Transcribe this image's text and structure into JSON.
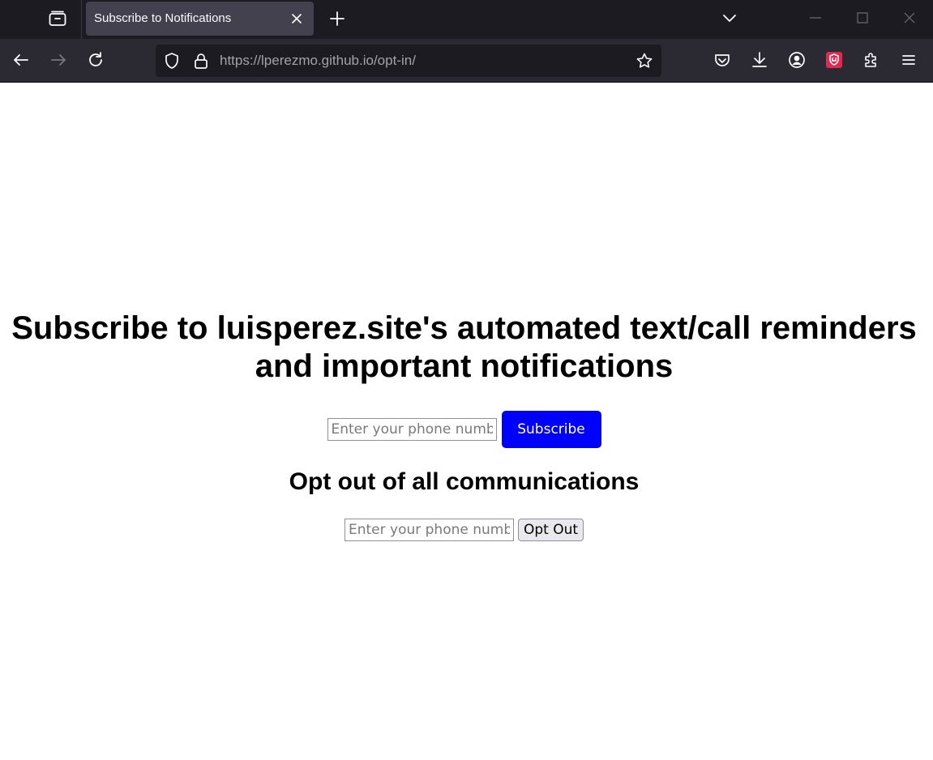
{
  "browser": {
    "tab_title": "Subscribe to Notifications",
    "url_host": "https://lperezmo.github.io",
    "url_path": "/opt-in/"
  },
  "icons": {
    "tab_overview": "tab-overview-icon",
    "close_tab": "close-icon",
    "new_tab": "plus-icon",
    "tab_list": "chevron-down-icon",
    "back": "arrow-left-icon",
    "forward": "arrow-right-icon",
    "reload": "reload-icon",
    "tracking_protection": "shield-icon",
    "site_security": "lock-icon",
    "bookmark": "star-icon",
    "pocket": "pocket-icon",
    "downloads": "download-icon",
    "account": "account-icon",
    "extension_shield": "ublock-icon",
    "extensions": "puzzle-icon",
    "menu": "hamburger-icon"
  },
  "colors": {
    "subscribe_button": "#0000ff",
    "extension_badge": "#e22850"
  },
  "page": {
    "headline": "Subscribe to luisperez.site's automated text/call reminders and important notifications",
    "subscribe_placeholder": "Enter your phone number",
    "subscribe_label": "Subscribe",
    "optout_heading": "Opt out of all communications",
    "optout_placeholder": "Enter your phone number",
    "optout_label": "Opt Out"
  }
}
